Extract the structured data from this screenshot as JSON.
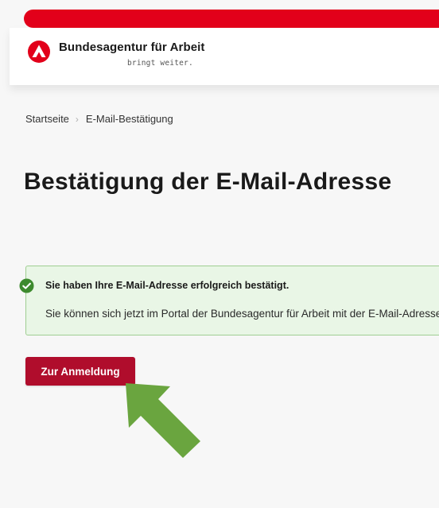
{
  "header": {
    "brand": "Bundesagentur für Arbeit",
    "tagline": "bringt weiter.",
    "logo_icon": "ba-logo-icon",
    "brand_color": "#e2001a"
  },
  "breadcrumb": {
    "items": [
      "Startseite",
      "E-Mail-Bestätigung"
    ],
    "separator": "›"
  },
  "page": {
    "title": "Bestätigung der E-Mail-Adresse"
  },
  "alert": {
    "icon": "check-circle-icon",
    "title": "Sie haben Ihre E-Mail-Adresse erfolgreich bestätigt.",
    "text": "Sie können sich jetzt im Portal der Bundesagentur für Arbeit mit der E-Mail-Adresse anmelden.",
    "color": "#3d8a2e"
  },
  "actions": {
    "login_label": "Zur Anmeldung",
    "login_color": "#b00d2c"
  },
  "annotation": {
    "icon": "pointer-arrow-icon",
    "color": "#6aa53f"
  }
}
